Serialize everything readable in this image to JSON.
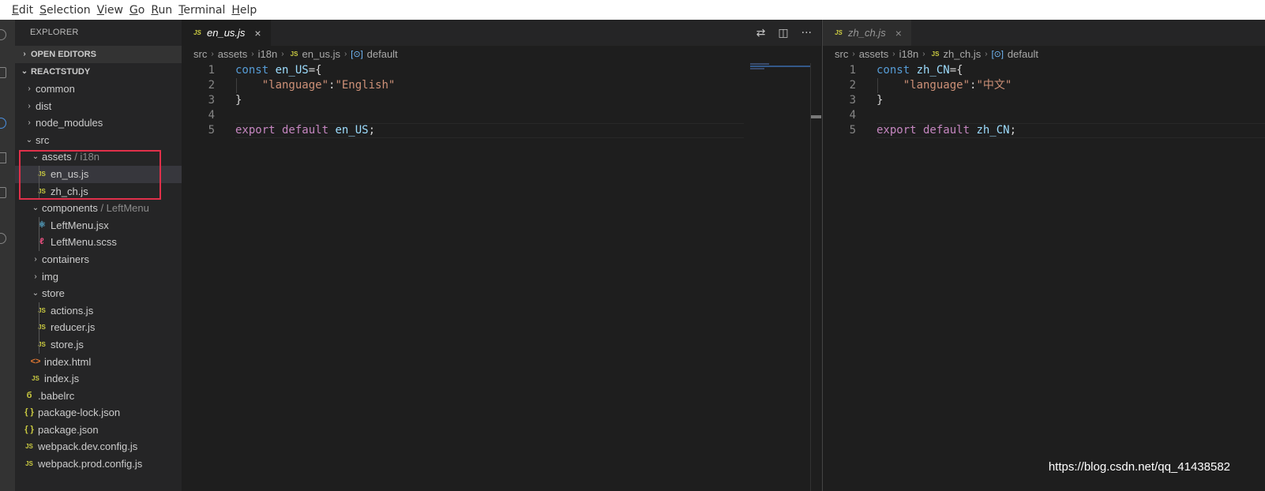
{
  "menu": [
    "Edit",
    "Selection",
    "View",
    "Go",
    "Run",
    "Terminal",
    "Help"
  ],
  "explorer": {
    "title": "EXPLORER",
    "open_editors": "OPEN EDITORS",
    "project": "REACTSTUDY",
    "tree": [
      {
        "indent": 1,
        "type": "folder",
        "open": false,
        "label": "common"
      },
      {
        "indent": 1,
        "type": "folder",
        "open": false,
        "label": "dist"
      },
      {
        "indent": 1,
        "type": "folder",
        "open": false,
        "label": "node_modules"
      },
      {
        "indent": 1,
        "type": "folder",
        "open": true,
        "label": "src"
      },
      {
        "indent": 2,
        "type": "folder",
        "open": true,
        "label": "assets",
        "suffix": " / i18n"
      },
      {
        "indent": 3,
        "type": "js",
        "label": "en_us.js",
        "selected": true
      },
      {
        "indent": 3,
        "type": "js",
        "label": "zh_ch.js"
      },
      {
        "indent": 2,
        "type": "folder",
        "open": true,
        "label": "components",
        "suffix": " / LeftMenu"
      },
      {
        "indent": 3,
        "type": "react",
        "label": "LeftMenu.jsx"
      },
      {
        "indent": 3,
        "type": "sass",
        "label": "LeftMenu.scss"
      },
      {
        "indent": 2,
        "type": "folder",
        "open": false,
        "label": "containers"
      },
      {
        "indent": 2,
        "type": "folder",
        "open": false,
        "label": "img"
      },
      {
        "indent": 2,
        "type": "folder",
        "open": true,
        "label": "store"
      },
      {
        "indent": 3,
        "type": "js",
        "label": "actions.js"
      },
      {
        "indent": 3,
        "type": "js",
        "label": "reducer.js"
      },
      {
        "indent": 3,
        "type": "js",
        "label": "store.js"
      },
      {
        "indent": 2,
        "type": "html",
        "label": "index.html"
      },
      {
        "indent": 2,
        "type": "js",
        "label": "index.js"
      },
      {
        "indent": 1,
        "type": "babel",
        "label": ".babelrc"
      },
      {
        "indent": 1,
        "type": "json",
        "label": "package-lock.json"
      },
      {
        "indent": 1,
        "type": "json",
        "label": "package.json"
      },
      {
        "indent": 1,
        "type": "js",
        "label": "webpack.dev.config.js"
      },
      {
        "indent": 1,
        "type": "js",
        "label": "webpack.prod.config.js"
      }
    ]
  },
  "icons": {
    "js": "JS",
    "json": "{ }",
    "react": "⚛",
    "sass": "ℓ",
    "html": "<>",
    "babel": "б",
    "chevron_right": "›",
    "chevron_down": "⌄",
    "close": "×",
    "more": "···",
    "split": "◫",
    "compare": "⇄",
    "symbol": "[⊙]"
  },
  "editors": [
    {
      "tab": "en_us.js",
      "breadcrumb": [
        "src",
        "assets",
        "i18n",
        "en_us.js",
        "default"
      ],
      "code": [
        [
          [
            "kw",
            "const "
          ],
          [
            "var",
            "en_US"
          ],
          [
            "pun",
            "={"
          ]
        ],
        [
          [
            "pun",
            "    "
          ],
          [
            "str",
            "\"language\""
          ],
          [
            "pun",
            ":"
          ],
          [
            "str",
            "\"English\""
          ]
        ],
        [
          [
            "pun",
            "}"
          ]
        ],
        [],
        [
          [
            "kw2",
            "export default "
          ],
          [
            "var",
            "en_US"
          ],
          [
            "pun",
            ";"
          ]
        ]
      ]
    },
    {
      "tab": "zh_ch.js",
      "breadcrumb": [
        "src",
        "assets",
        "i18n",
        "zh_ch.js",
        "default"
      ],
      "code": [
        [
          [
            "kw",
            "const "
          ],
          [
            "var",
            "zh_CN"
          ],
          [
            "pun",
            "={"
          ]
        ],
        [
          [
            "pun",
            "    "
          ],
          [
            "str",
            "\"language\""
          ],
          [
            "pun",
            ":"
          ],
          [
            "str",
            "\"中文\""
          ]
        ],
        [
          [
            "pun",
            "}"
          ]
        ],
        [],
        [
          [
            "kw2",
            "export default "
          ],
          [
            "var",
            "zh_CN"
          ],
          [
            "pun",
            ";"
          ]
        ]
      ]
    }
  ],
  "watermark": "https://blog.csdn.net/qq_41438582",
  "colors": {
    "highlight_box": "#e0304a",
    "js_icon": "#cbcb41"
  }
}
